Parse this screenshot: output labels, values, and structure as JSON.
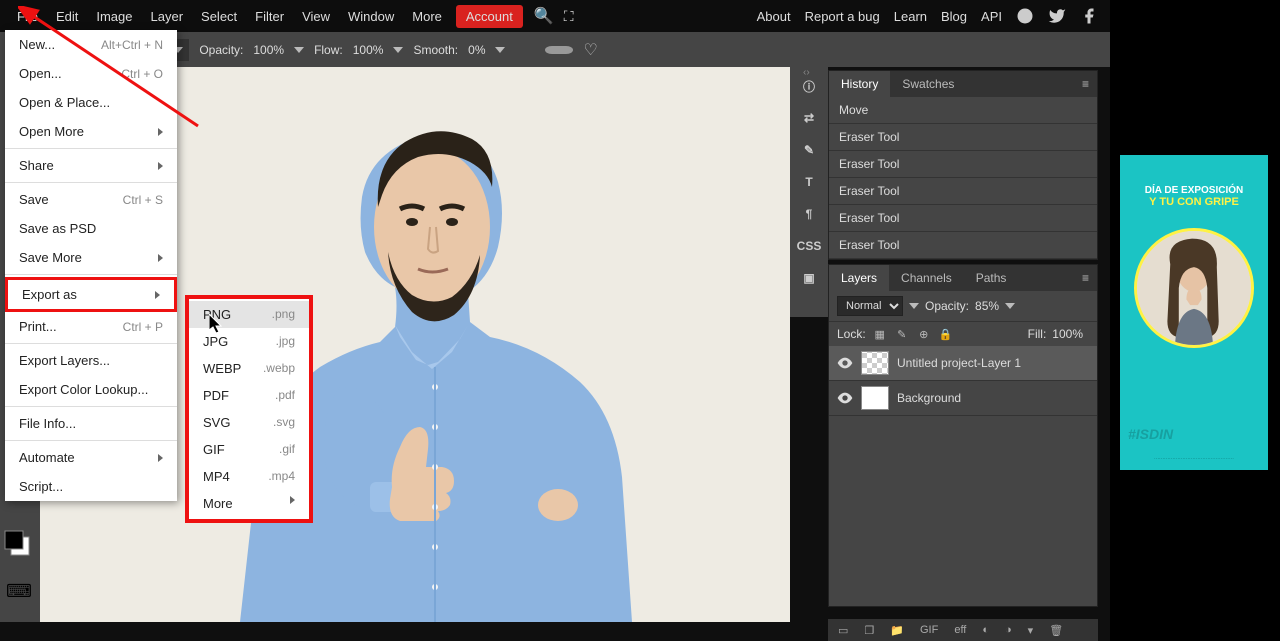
{
  "menubar": {
    "items": [
      "File",
      "Edit",
      "Image",
      "Layer",
      "Select",
      "Filter",
      "View",
      "Window",
      "More"
    ],
    "account": "Account",
    "right_links": [
      "About",
      "Report a bug",
      "Learn",
      "Blog",
      "API"
    ]
  },
  "optbar": {
    "opacity_label": "Opacity:",
    "opacity_val": "100%",
    "flow_label": "Flow:",
    "flow_val": "100%",
    "smooth_label": "Smooth:",
    "smooth_val": "0%"
  },
  "file_menu": [
    {
      "label": "New...",
      "shortcut": "Alt+Ctrl + N"
    },
    {
      "label": "Open...",
      "shortcut": "Ctrl + O"
    },
    {
      "label": "Open & Place..."
    },
    {
      "label": "Open More",
      "submenu": true
    },
    {
      "sep": true
    },
    {
      "label": "Share",
      "submenu": true
    },
    {
      "sep": true
    },
    {
      "label": "Save",
      "shortcut": "Ctrl + S"
    },
    {
      "label": "Save as PSD"
    },
    {
      "label": "Save More",
      "submenu": true
    },
    {
      "sep": true
    },
    {
      "label": "Export as",
      "submenu": true,
      "highlight": true
    },
    {
      "label": "Print...",
      "shortcut": "Ctrl + P"
    },
    {
      "sep": true
    },
    {
      "label": "Export Layers..."
    },
    {
      "label": "Export Color Lookup..."
    },
    {
      "sep": true
    },
    {
      "label": "File Info..."
    },
    {
      "sep": true
    },
    {
      "label": "Automate",
      "submenu": true
    },
    {
      "label": "Script..."
    }
  ],
  "export_menu": [
    {
      "label": "PNG",
      "ext": ".png",
      "hover": true
    },
    {
      "label": "JPG",
      "ext": ".jpg"
    },
    {
      "label": "WEBP",
      "ext": ".webp"
    },
    {
      "label": "PDF",
      "ext": ".pdf"
    },
    {
      "label": "SVG",
      "ext": ".svg"
    },
    {
      "label": "GIF",
      "ext": ".gif"
    },
    {
      "label": "MP4",
      "ext": ".mp4"
    },
    {
      "label": "More",
      "submenu": true
    }
  ],
  "history_panel": {
    "tabs": [
      "History",
      "Swatches"
    ],
    "items": [
      "Move",
      "Eraser Tool",
      "Eraser Tool",
      "Eraser Tool",
      "Eraser Tool",
      "Eraser Tool"
    ]
  },
  "layers_panel": {
    "tabs": [
      "Layers",
      "Channels",
      "Paths"
    ],
    "blend_mode": "Normal",
    "opacity_label": "Opacity:",
    "opacity_val": "85%",
    "lock_label": "Lock:",
    "fill_label": "Fill:",
    "fill_val": "100%",
    "layers": [
      {
        "name": "Untitled project-Layer 1",
        "selected": true,
        "checker": true
      },
      {
        "name": "Background"
      }
    ]
  },
  "icon_col": [
    "ⓘ",
    "⇄",
    "✎",
    "T",
    "¶",
    "CSS",
    "▣"
  ],
  "status": {
    "gif": "GIF",
    "eff": "eff"
  },
  "ad": {
    "line1": "DÍA DE EXPOSICIÓN",
    "line2": "Y TU CON GRIPE",
    "brand": "#ISDIN"
  }
}
